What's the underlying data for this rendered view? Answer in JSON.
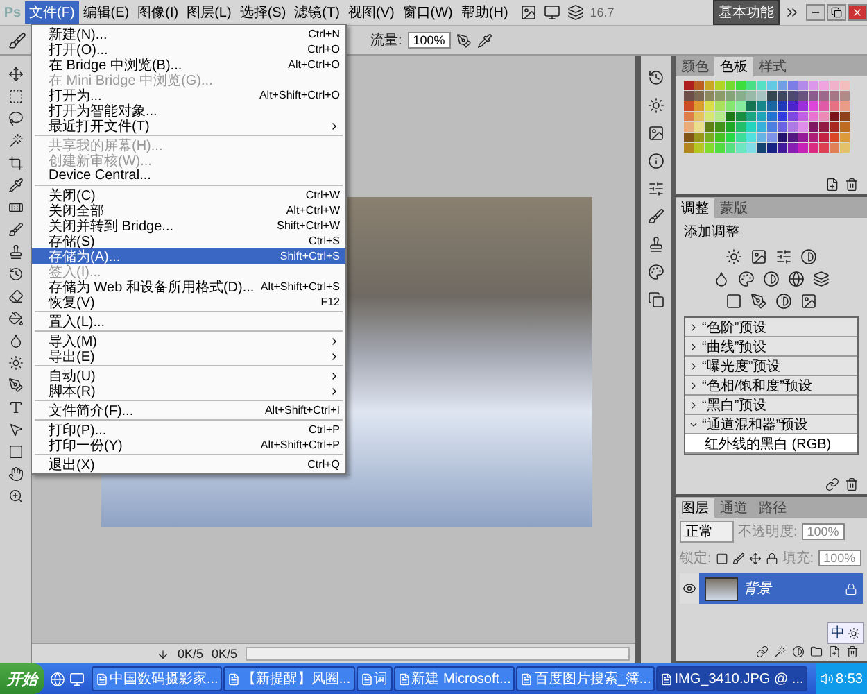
{
  "menubar": {
    "logo": "Ps",
    "items": [
      {
        "label": "文件(F)",
        "selected": true
      },
      {
        "label": "编辑(E)",
        "selected": false
      },
      {
        "label": "图像(I)",
        "selected": false
      },
      {
        "label": "图层(L)",
        "selected": false
      },
      {
        "label": "选择(S)",
        "selected": false
      },
      {
        "label": "滤镜(T)",
        "selected": false
      },
      {
        "label": "视图(V)",
        "selected": false
      },
      {
        "label": "窗口(W)",
        "selected": false
      },
      {
        "label": "帮助(H)",
        "selected": false
      }
    ],
    "zoom": "16.7",
    "workspace": "基本功能"
  },
  "options_bar": {
    "flow_label": "流量:",
    "flow_value": "100%"
  },
  "file_menu": {
    "groups": [
      [
        {
          "label": "新建(N)...",
          "shortcut": "Ctrl+N",
          "disabled": false,
          "selected": false,
          "submenu": false
        },
        {
          "label": "打开(O)...",
          "shortcut": "Ctrl+O",
          "disabled": false,
          "selected": false,
          "submenu": false
        },
        {
          "label": "在 Bridge 中浏览(B)...",
          "shortcut": "Alt+Ctrl+O",
          "disabled": false,
          "selected": false,
          "submenu": false
        },
        {
          "label": "在 Mini Bridge 中浏览(G)...",
          "disabled": true,
          "selected": false,
          "submenu": false
        },
        {
          "label": "打开为...",
          "shortcut": "Alt+Shift+Ctrl+O",
          "disabled": false,
          "selected": false,
          "submenu": false
        },
        {
          "label": "打开为智能对象...",
          "disabled": false,
          "selected": false,
          "submenu": false
        },
        {
          "label": "最近打开文件(T)",
          "disabled": false,
          "selected": false,
          "submenu": true
        }
      ],
      [
        {
          "label": "共享我的屏幕(H)...",
          "disabled": true,
          "selected": false,
          "submenu": false
        },
        {
          "label": "创建新审核(W)...",
          "disabled": true,
          "selected": false,
          "submenu": false
        },
        {
          "label": "Device Central...",
          "disabled": false,
          "selected": false,
          "submenu": false
        }
      ],
      [
        {
          "label": "关闭(C)",
          "shortcut": "Ctrl+W",
          "disabled": false,
          "selected": false,
          "submenu": false
        },
        {
          "label": "关闭全部",
          "shortcut": "Alt+Ctrl+W",
          "disabled": false,
          "selected": false,
          "submenu": false
        },
        {
          "label": "关闭并转到 Bridge...",
          "shortcut": "Shift+Ctrl+W",
          "disabled": false,
          "selected": false,
          "submenu": false
        },
        {
          "label": "存储(S)",
          "shortcut": "Ctrl+S",
          "disabled": false,
          "selected": false,
          "submenu": false
        },
        {
          "label": "存储为(A)...",
          "shortcut": "Shift+Ctrl+S",
          "disabled": false,
          "selected": true,
          "submenu": false
        },
        {
          "label": "签入(I)...",
          "disabled": true,
          "selected": false,
          "submenu": false
        },
        {
          "label": "存储为 Web 和设备所用格式(D)...",
          "shortcut": "Alt+Shift+Ctrl+S",
          "disabled": false,
          "selected": false,
          "submenu": false
        },
        {
          "label": "恢复(V)",
          "shortcut": "F12",
          "disabled": false,
          "selected": false,
          "submenu": false
        }
      ],
      [
        {
          "label": "置入(L)...",
          "disabled": false,
          "selected": false,
          "submenu": false
        }
      ],
      [
        {
          "label": "导入(M)",
          "disabled": false,
          "selected": false,
          "submenu": true
        },
        {
          "label": "导出(E)",
          "disabled": false,
          "selected": false,
          "submenu": true
        }
      ],
      [
        {
          "label": "自动(U)",
          "disabled": false,
          "selected": false,
          "submenu": true
        },
        {
          "label": "脚本(R)",
          "disabled": false,
          "selected": false,
          "submenu": true
        }
      ],
      [
        {
          "label": "文件简介(F)...",
          "shortcut": "Alt+Shift+Ctrl+I",
          "disabled": false,
          "selected": false,
          "submenu": false
        }
      ],
      [
        {
          "label": "打印(P)...",
          "shortcut": "Ctrl+P",
          "disabled": false,
          "selected": false,
          "submenu": false
        },
        {
          "label": "打印一份(Y)",
          "shortcut": "Alt+Shift+Ctrl+P",
          "disabled": false,
          "selected": false,
          "submenu": false
        }
      ],
      [
        {
          "label": "退出(X)",
          "shortcut": "Ctrl+Q",
          "disabled": false,
          "selected": false,
          "submenu": false
        }
      ]
    ]
  },
  "swatches_panel": {
    "tabs": [
      {
        "label": "颜色",
        "selected": false
      },
      {
        "label": "色板",
        "selected": true
      },
      {
        "label": "样式",
        "selected": false
      }
    ]
  },
  "adjustments_panel": {
    "tabs": [
      {
        "label": "调整",
        "selected": true
      },
      {
        "label": "蒙版",
        "selected": false
      }
    ],
    "title": "添加调整",
    "presets": [
      {
        "label": "“色阶”预设",
        "expanded": false
      },
      {
        "label": "“曲线”预设",
        "expanded": false
      },
      {
        "label": "“曝光度”预设",
        "expanded": false
      },
      {
        "label": "“色相/饱和度”预设",
        "expanded": false
      },
      {
        "label": "“黑白”预设",
        "expanded": false
      },
      {
        "label": "“通道混和器”预设",
        "expanded": true,
        "children": [
          {
            "label": "红外线的黑白 (RGB)"
          }
        ]
      }
    ]
  },
  "layers_panel": {
    "tabs": [
      {
        "label": "图层",
        "selected": true
      },
      {
        "label": "通道",
        "selected": false
      },
      {
        "label": "路径",
        "selected": false
      }
    ],
    "blend_mode": "正常",
    "opacity_label": "不透明度:",
    "opacity_value": "100%",
    "lock_label": "锁定:",
    "fill_label": "填充:",
    "fill_value": "100%",
    "layers": [
      {
        "name": "背景",
        "selected": true,
        "visible": true
      }
    ]
  },
  "status_bar": {
    "items": [
      "0K/5",
      "0K/5"
    ]
  },
  "ime_bar": {
    "label": "中"
  },
  "taskbar": {
    "start": "开始",
    "tasks": [
      {
        "label": "中国数码摄影家...",
        "selected": false
      },
      {
        "label": "【新提醒】风圈...",
        "selected": false
      },
      {
        "label": "词",
        "selected": false
      },
      {
        "label": "新建 Microsoft...",
        "selected": false
      },
      {
        "label": "百度图片搜索_簿...",
        "selected": false
      },
      {
        "label": "IMG_3410.JPG @ ...",
        "selected": true
      }
    ],
    "clock": "8:53"
  }
}
